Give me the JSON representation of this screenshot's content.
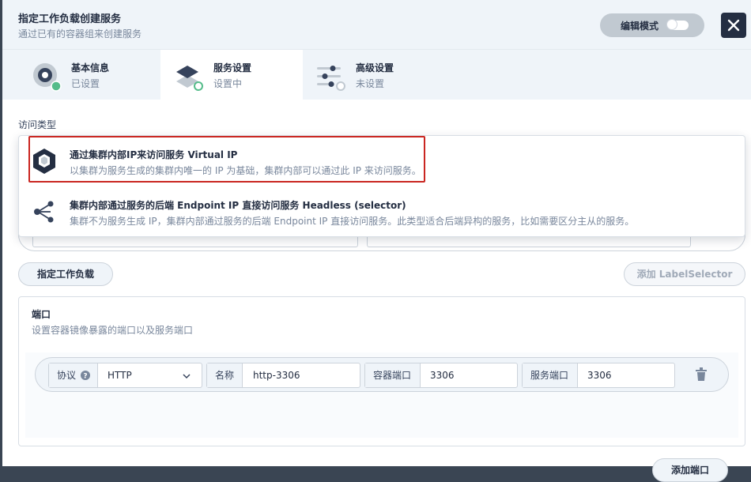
{
  "header": {
    "title": "指定工作负载创建服务",
    "subtitle": "通过已有的容器组来创建服务",
    "edit_mode_label": "编辑模式",
    "close_icon": "close-icon"
  },
  "tabs": [
    {
      "name": "基本信息",
      "status": "已设置",
      "icon": "basic-info-icon"
    },
    {
      "name": "服务设置",
      "status": "设置中",
      "icon": "service-settings-icon"
    },
    {
      "name": "高级设置",
      "status": "未设置",
      "icon": "advanced-settings-icon"
    }
  ],
  "access_type": {
    "label": "访问类型",
    "options": [
      {
        "title": "通过集群内部IP来访问服务 Virtual IP",
        "desc": "以集群为服务生成的集群内唯一的 IP 为基础，集群内部可以通过此 IP 来访问服务。",
        "icon": "virtual-ip-icon"
      },
      {
        "title": "集群内部通过服务的后端 Endpoint IP 直接访问服务 Headless (selector)",
        "desc": "集群不为服务生成 IP，集群内部通过服务的后端 Endpoint IP 直接访问服务。此类型适合后端异构的服务，比如需要区分主从的服务。",
        "icon": "headless-icon"
      }
    ]
  },
  "buttons": {
    "specify_workload": "指定工作负载",
    "add_label_selector": "添加 LabelSelector",
    "add_port": "添加端口"
  },
  "ports": {
    "title": "端口",
    "desc": "设置容器镜像暴露的端口以及服务端口",
    "rows": [
      {
        "protocol_label": "协议",
        "protocol_value": "HTTP",
        "name_label": "名称",
        "name_value": "http-3306",
        "container_port_label": "容器端口",
        "container_port_value": "3306",
        "service_port_label": "服务端口",
        "service_port_value": "3306"
      }
    ]
  },
  "colors": {
    "accent_green": "#55bc8a",
    "highlight_red": "#ca2621",
    "dark": "#242e42"
  }
}
